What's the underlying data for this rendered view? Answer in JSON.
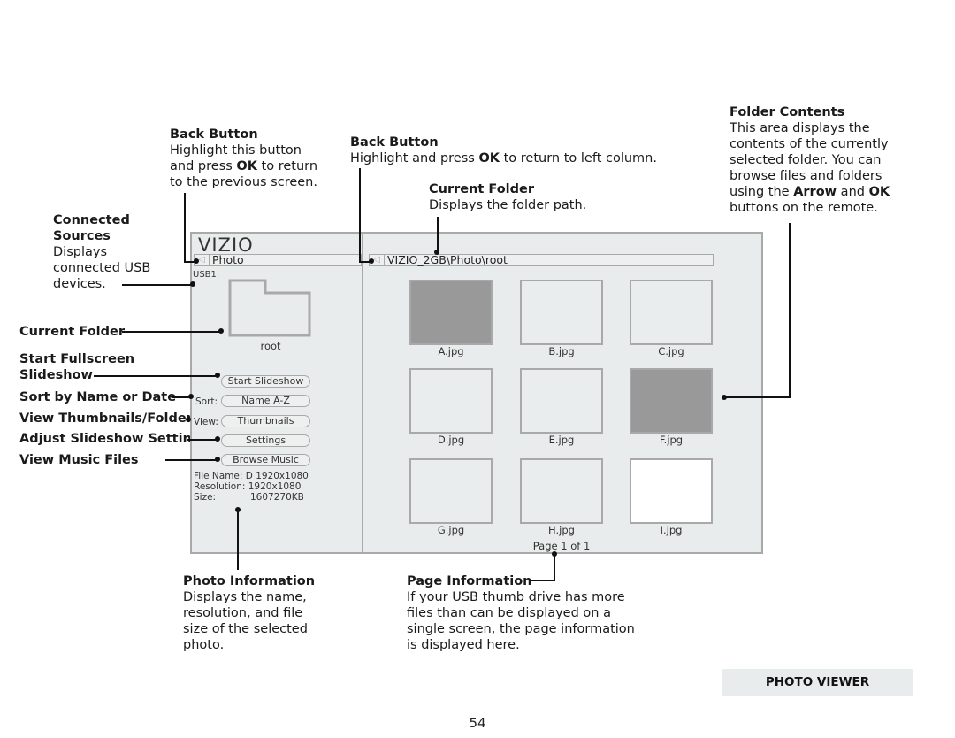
{
  "callouts": {
    "back_button_left": {
      "title": "Back Button",
      "lines": [
        "Highlight this button",
        "and press ",
        "OK",
        " to return",
        "to the previous screen."
      ]
    },
    "back_button_right": {
      "title": "Back Button",
      "pre": "Highlight and press ",
      "bold": "OK",
      "post": " to return to left column."
    },
    "current_folder_path": {
      "title": "Current Folder",
      "text": "Displays the folder path."
    },
    "folder_contents": {
      "title": "Folder Contents",
      "line1": "This area displays the",
      "line2": "contents of the currently",
      "line3": "selected folder. You can",
      "line4": "browse files and folders",
      "line5_pre": "using the ",
      "line5_bold1": "Arrow",
      "line5_mid": " and ",
      "line5_bold2": "OK",
      "line6": "buttons on the remote."
    },
    "connected_sources": {
      "title1": "Connected",
      "title2": "Sources",
      "line1": "Displays",
      "line2": "connected USB",
      "line3": "devices."
    },
    "current_folder": "Current Folder",
    "start_fullscreen_1": "Start Fullscreen",
    "start_fullscreen_2": "Slideshow",
    "sort": "Sort by Name or Date",
    "view": "View Thumbnails/Folders",
    "settings": "Adjust Slideshow Settings",
    "music": "View Music Files",
    "photo_info": {
      "title": "Photo Information",
      "line1": "Displays the name,",
      "line2": "resolution, and file",
      "line3": "size of the selected",
      "line4": "photo."
    },
    "page_info": {
      "title": "Page Information",
      "line1": "If your USB thumb drive has more",
      "line2": "files than can be displayed on a",
      "line3": "single screen, the page information",
      "line4": "is displayed here."
    }
  },
  "screen": {
    "logo": "VIZIO",
    "left_path": "Photo",
    "right_path": "VIZIO_2GB\\Photo\\root",
    "back_icon": "left-triangle-icon",
    "source_label": "USB1:",
    "folder_name": "root",
    "buttons": {
      "start_slideshow": "Start Slideshow",
      "sort_label": "Sort:",
      "sort_value": "Name A-Z",
      "view_label": "View:",
      "view_value": "Thumbnails",
      "settings": "Settings",
      "browse_music": "Browse Music"
    },
    "photo_info": {
      "file_name_label": "File Name:",
      "file_name": "D 1920x1080",
      "resolution_label": "Resolution:",
      "resolution": "1920x1080",
      "size_label": "Size:",
      "size": "1607270KB"
    },
    "thumbnails": [
      {
        "name": "A.jpg",
        "fill": "#999999"
      },
      {
        "name": "B.jpg",
        "fill": "#eaeded"
      },
      {
        "name": "C.jpg",
        "fill": "#eaeded"
      },
      {
        "name": "D.jpg",
        "fill": "#eaeded"
      },
      {
        "name": "E.jpg",
        "fill": "#eaeded"
      },
      {
        "name": "F.jpg",
        "fill": "#999999"
      },
      {
        "name": "G.jpg",
        "fill": "#eaeded"
      },
      {
        "name": "H.jpg",
        "fill": "#eaeded"
      },
      {
        "name": "I.jpg",
        "fill": "#ffffff"
      }
    ],
    "page_info": "Page 1 of 1"
  },
  "footer": {
    "section": "PHOTO VIEWER",
    "page_number": "54"
  }
}
